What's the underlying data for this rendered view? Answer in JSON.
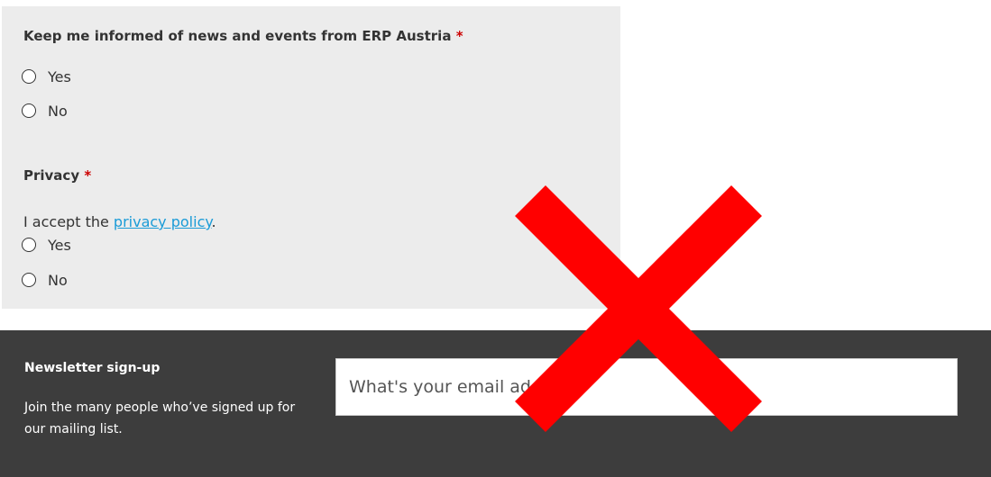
{
  "form": {
    "news_question": "Keep me informed of news and events from ERP Austria",
    "news_required_marker": "*",
    "news_options": [
      "Yes",
      "No"
    ],
    "privacy_question": "Privacy",
    "privacy_required_marker": "*",
    "privacy_accept_prefix": "I accept the",
    "privacy_link_text": "privacy policy",
    "privacy_accept_suffix": ".",
    "privacy_options": [
      "Yes",
      "No"
    ]
  },
  "footer": {
    "title": "Newsletter sign-up",
    "description": "Join the many people who’ve signed up for our mailing list.",
    "email_placeholder": "What's your email address?"
  },
  "overlay": {
    "icon": "red-x-icon",
    "color": "#ff0000"
  },
  "colors": {
    "panel_background": "#ececec",
    "footer_background": "#3d3d3d",
    "link": "#1a9bd7",
    "required": "#cc0000"
  }
}
